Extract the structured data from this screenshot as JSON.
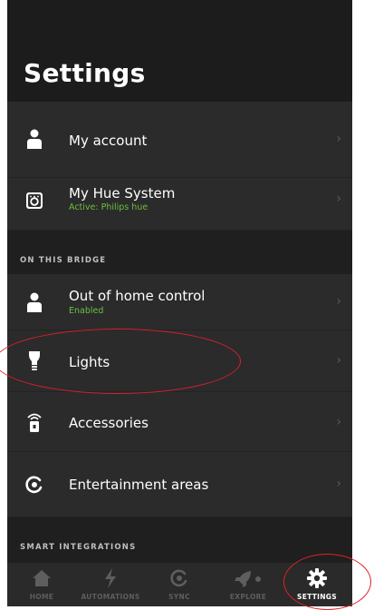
{
  "page": {
    "title": "Settings"
  },
  "rows": {
    "my_account": {
      "label": "My account",
      "icon": "person-icon"
    },
    "my_hue_system": {
      "label": "My Hue System",
      "sub": "Active: Philips hue",
      "icon": "bridge-icon"
    },
    "out_of_home": {
      "label": "Out of home control",
      "sub": "Enabled",
      "icon": "person-icon"
    },
    "lights": {
      "label": "Lights",
      "icon": "bulb-icon"
    },
    "accessories": {
      "label": "Accessories",
      "icon": "remote-icon"
    },
    "entertainment": {
      "label": "Entertainment areas",
      "icon": "entertainment-icon"
    }
  },
  "sections": {
    "on_this_bridge": "ON THIS BRIDGE",
    "smart_integrations": "SMART INTEGRATIONS"
  },
  "chevron": "›",
  "tabs": [
    {
      "label": "HOME",
      "icon": "home-icon",
      "active": false
    },
    {
      "label": "AUTOMATIONS",
      "icon": "lightning-icon",
      "active": false
    },
    {
      "label": "SYNC",
      "icon": "sync-icon",
      "active": false
    },
    {
      "label": "EXPLORE",
      "icon": "rocket-icon",
      "active": false
    },
    {
      "label": "SETTINGS",
      "icon": "gear-icon",
      "active": true
    }
  ],
  "colors": {
    "background": "#1c1c1c",
    "row": "#2b2b2b",
    "accent_green": "#6abf40",
    "annotation_red": "#e0202a"
  }
}
